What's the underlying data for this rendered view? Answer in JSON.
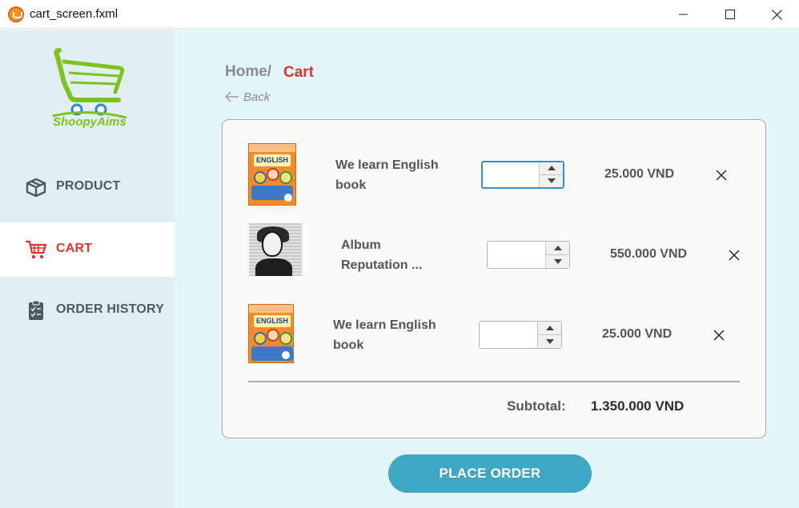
{
  "window": {
    "title": "cart_screen.fxml"
  },
  "sidebar": {
    "logo_text": "ShoopyAims",
    "items": [
      {
        "label": "PRODUCT",
        "icon": "box-icon",
        "active": false
      },
      {
        "label": "CART",
        "icon": "shopping-cart-icon",
        "active": true
      },
      {
        "label": "ORDER HISTORY",
        "icon": "clipboard-icon",
        "active": false
      }
    ]
  },
  "breadcrumb": {
    "home": "Home/",
    "current": "Cart",
    "back": "Back"
  },
  "cart": {
    "items": [
      {
        "name_line1": "We learn English",
        "name_line2": "book",
        "quantity": "",
        "price": "25.000 VND",
        "thumbnail": "book-cover"
      },
      {
        "name_line1": "Album",
        "name_line2": "Reputation ...",
        "quantity": "",
        "price": "550.000 VND",
        "thumbnail": "album-cover"
      },
      {
        "name_line1": "We learn English",
        "name_line2": "book",
        "quantity": "",
        "price": "25.000 VND",
        "thumbnail": "book-cover"
      }
    ],
    "subtotal_label": "Subtotal:",
    "subtotal_value": "1.350.000 VND"
  },
  "actions": {
    "place_order": "PLACE ORDER"
  },
  "colors": {
    "accent_red": "#e0332f",
    "button_blue": "#3fa6c4",
    "sidebar_bg": "#e1eff3",
    "main_bg": "#e1f5fb",
    "logo_green": "#7fc21f"
  }
}
